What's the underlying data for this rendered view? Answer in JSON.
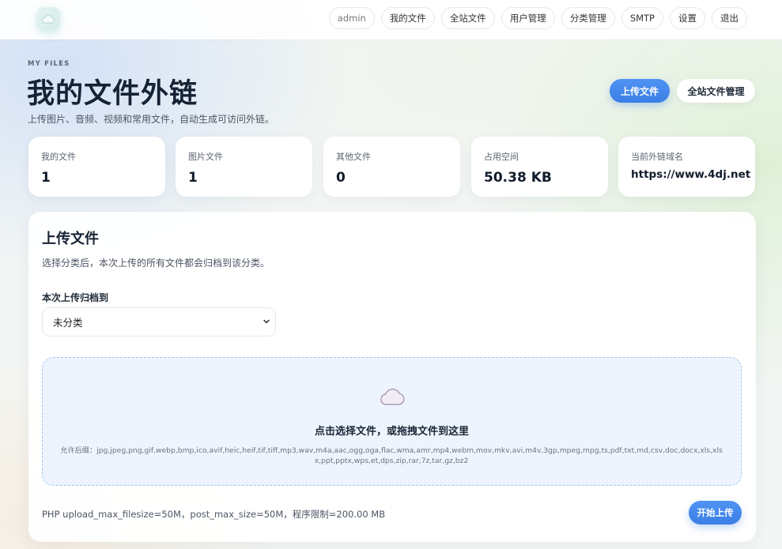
{
  "nav": {
    "logo_icon": "cloud-icon",
    "items": [
      {
        "label": "admin"
      },
      {
        "label": "我的文件"
      },
      {
        "label": "全站文件"
      },
      {
        "label": "用户管理"
      },
      {
        "label": "分类管理"
      },
      {
        "label": "SMTP"
      },
      {
        "label": "设置"
      },
      {
        "label": "退出"
      }
    ]
  },
  "hero": {
    "eyebrow": "MY FILES",
    "title": "我的文件外链",
    "subtitle": "上传图片、音频、视频和常用文件，自动生成可访问外链。",
    "upload_button": "上传文件",
    "manage_button": "全站文件管理"
  },
  "stats": [
    {
      "label": "我的文件",
      "value": "1"
    },
    {
      "label": "图片文件",
      "value": "1"
    },
    {
      "label": "其他文件",
      "value": "0"
    },
    {
      "label": "占用空间",
      "value": "50.38 KB"
    },
    {
      "label": "当前外链域名",
      "value": "https://www.4dj.net"
    }
  ],
  "upload": {
    "title": "上传文件",
    "description": "选择分类后，本次上传的所有文件都会归档到该分类。",
    "category_label": "本次上传归档到",
    "category_selected": "未分类",
    "drop_icon": "cloud-icon",
    "drop_title": "点击选择文件，或拖拽文件到这里",
    "allowed_extensions": "允许后缀：jpg,jpeg,png,gif,webp,bmp,ico,avif,heic,heif,tif,tiff,mp3,wav,m4a,aac,ogg,oga,flac,wma,amr,mp4,webm,mov,mkv,avi,m4v,3gp,mpeg,mpg,ts,pdf,txt,md,csv,doc,docx,xls,xlsx,ppt,pptx,wps,et,dps,zip,rar,7z,tar,gz,bz2",
    "limits": "PHP upload_max_filesize=50M，post_max_size=50M，程序限制=200.00 MB",
    "start_button": "开始上传"
  },
  "colors": {
    "accent": "#3b7fe6",
    "dropzone_bg": "#edf4fe",
    "dropzone_border": "#a9c7ef"
  }
}
